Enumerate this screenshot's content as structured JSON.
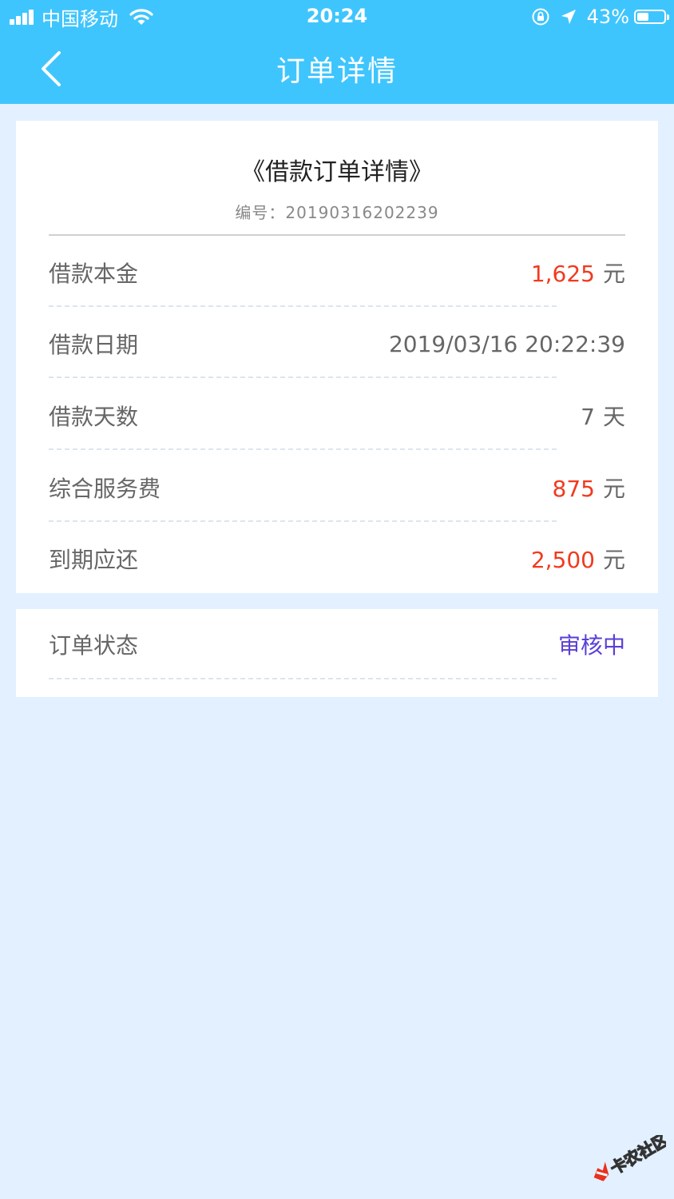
{
  "status_bar": {
    "carrier": "中国移动",
    "time": "20:24",
    "battery_percent": "43%",
    "battery_level": 0.43
  },
  "nav": {
    "title": "订单详情"
  },
  "document": {
    "title": "《借款订单详情》",
    "number": "编号：20190316202239"
  },
  "rows": [
    {
      "label": "借款本金",
      "value": "1,625",
      "unit": "元"
    },
    {
      "label": "借款日期",
      "value": "2019/03/16 20:22:39",
      "unit": ""
    },
    {
      "label": "借款天数",
      "value": "7",
      "unit": "天"
    },
    {
      "label": "综合服务费",
      "value": "875",
      "unit": "元"
    },
    {
      "label": "到期应还",
      "value": "2,500",
      "unit": "元"
    }
  ],
  "order_status": {
    "label": "订单状态",
    "value": "审核中"
  },
  "watermark": {
    "text": "卡农社区"
  },
  "colors": {
    "header": "#3fc5fd",
    "background": "#e2f0ff",
    "amount_red": "#f13a1f",
    "status_purple": "#5a3fd6",
    "label_grey": "#666666"
  }
}
